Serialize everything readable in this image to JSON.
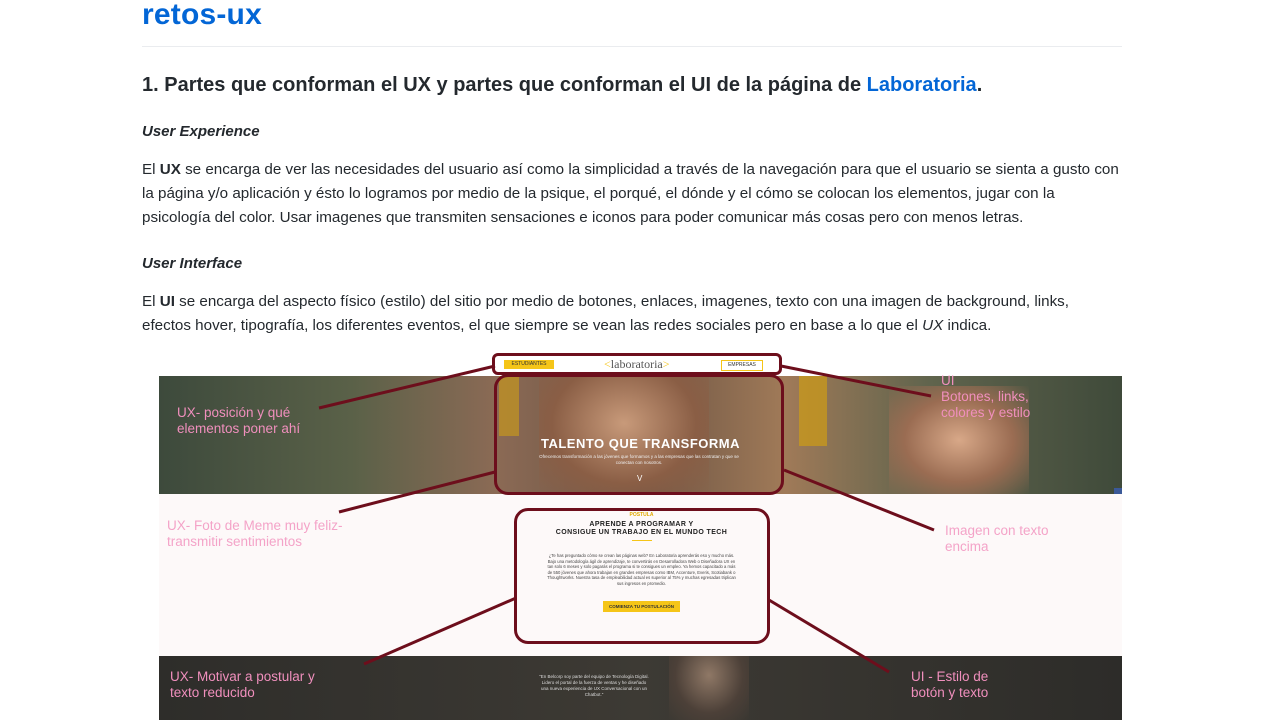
{
  "title": "retos-ux",
  "heading": {
    "prefix": "1. Partes que conforman el UX y partes que conforman el UI de la página de",
    "link": "Laboratoria",
    "suffix": "."
  },
  "ux_section": {
    "subtitle": "User Experience",
    "para_lead": "El ",
    "para_bold": "UX",
    "para_rest": " se encarga de ver las necesidades del usuario así como la simplicidad a través de la navegación para que el usuario se sienta a gusto con la página y/o aplicación y ésto lo logramos por medio de la psique, el porqué, el dónde y el cómo se colocan los elementos, jugar con la psicología del color. Usar imagenes que transmiten sensaciones e iconos para poder comunicar más cosas pero con menos letras."
  },
  "ui_section": {
    "subtitle": "User Interface",
    "para_lead": "El ",
    "para_bold": "UI",
    "para_mid": " se encarga del aspecto físico (estilo) del sitio por medio de botones, enlaces, imagenes, texto con una imagen de background, links, efectos hover, tipografía, los diferentes eventos, el que siempre se vean las redes sociales pero en base a lo que el ",
    "para_em": "UX",
    "para_end": " indica."
  },
  "screenshot": {
    "nav": {
      "students": "ESTUDIANTES",
      "logo": "laboratoria",
      "companies": "EMPRESAS"
    },
    "hero": {
      "title": "TALENTO QUE TRANSFORMA",
      "subtitle": "Ofrecemos transformación a las jóvenes que formamos y a las empresas que las contratan y que se conectan con nosotros.",
      "arrow": "V"
    },
    "card": {
      "label": "POSTULA",
      "title_1": "APRENDE A PROGRAMAR Y",
      "title_2": "CONSIGUE UN TRABAJO EN EL MUNDO TECH",
      "body": "¿Te has preguntado cómo se crean las páginas web? En Laboratoria aprenderás eso y mucho más. Bajo una metodología ágil de aprendizaje, te convertirás en Desarrolladora Web o Diseñadora UX en tan solo 6 meses y solo pagarás el programa si te consigues un empleo. Ya hemos capacitado a más de 550 jóvenes que ahora trabajan en grandes empresas como IBM, Accenture, Everis, Scotiabank o Thoughtworks. Nuestra tasa de empleabilidad actual es superior al 75% y muchas egresadas triplican sus ingresos en promedio.",
      "button": "COMIENZA TU POSTULACIÓN"
    },
    "quote": "\"En Belcorp soy parte del equipo de Tecnología Digital. Lidero el portal de la fuerza de ventas y he diseñado una nueva experiencia de UX Conversacional con un Chatbot.\"",
    "annotations": {
      "ux_position": [
        "UX- posición y qué",
        "elementos poner ahí"
      ],
      "ui_buttons": [
        "UI",
        "Botones, links,",
        "colores y estilo"
      ],
      "ux_photo": [
        "UX- Foto de Meme muy feliz-",
        "transmitir sentimientos"
      ],
      "image_text": [
        "Imagen con texto",
        "encima"
      ],
      "ux_motivate": [
        "UX- Motivar a postular y",
        "texto reducido"
      ],
      "ui_button_style": [
        "UI - Estilo de",
        "botón y texto"
      ]
    }
  },
  "colors": {
    "link": "#0366d6",
    "annotation": "#f08fbd",
    "frame": "#6d0e1c",
    "brand_yellow": "#f5c518"
  }
}
